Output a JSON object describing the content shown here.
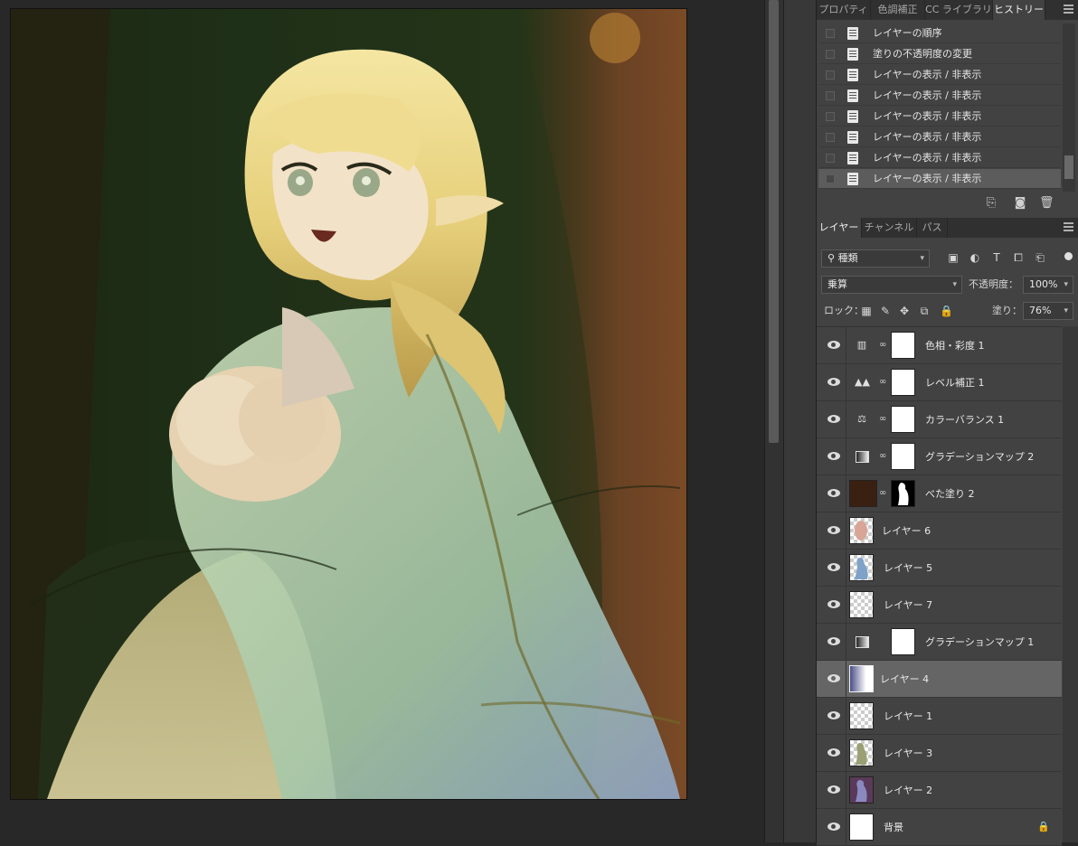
{
  "panels": {
    "top_tabs": [
      {
        "label": "プロパティ"
      },
      {
        "label": "色調補正"
      },
      {
        "label": "CC ライブラリ"
      },
      {
        "label": "ヒストリー"
      }
    ],
    "history": {
      "items": [
        {
          "label": "レイヤーの順序"
        },
        {
          "label": "塗りの不透明度の変更"
        },
        {
          "label": "レイヤーの表示 / 非表示"
        },
        {
          "label": "レイヤーの表示 / 非表示"
        },
        {
          "label": "レイヤーの表示 / 非表示"
        },
        {
          "label": "レイヤーの表示 / 非表示"
        },
        {
          "label": "レイヤーの表示 / 非表示"
        },
        {
          "label": "レイヤーの表示 / 非表示"
        }
      ]
    },
    "layers_tabs": [
      {
        "label": "レイヤー"
      },
      {
        "label": "チャンネル"
      },
      {
        "label": "パス"
      }
    ],
    "layers": {
      "filter_kind": "種類",
      "blend_mode": "乗算",
      "opacity_label": "不透明度：",
      "opacity_value": "100%",
      "lock_label": "ロック：",
      "fill_label": "塗り：",
      "fill_value": "76%",
      "items": [
        {
          "name": "色相・彩度 1",
          "icon": "hue-saturation-icon"
        },
        {
          "name": "レベル補正 1",
          "icon": "levels-icon"
        },
        {
          "name": "カラーバランス 1",
          "icon": "color-balance-icon"
        },
        {
          "name": "グラデーションマップ 2",
          "icon": "gradient-map-icon"
        },
        {
          "name": "べた塗り 2",
          "icon": "solid-fill-icon"
        },
        {
          "name": "レイヤー 6",
          "icon": "layer-thumbnail"
        },
        {
          "name": "レイヤー 5",
          "icon": "layer-thumbnail"
        },
        {
          "name": "レイヤー 7",
          "icon": "layer-thumbnail"
        },
        {
          "name": "グラデーションマップ 1",
          "icon": "gradient-map-icon"
        },
        {
          "name": "レイヤー 4",
          "icon": "layer-thumbnail"
        },
        {
          "name": "レイヤー 1",
          "icon": "layer-thumbnail"
        },
        {
          "name": "レイヤー 3",
          "icon": "layer-thumbnail"
        },
        {
          "name": "レイヤー 2",
          "icon": "layer-thumbnail"
        },
        {
          "name": "背景",
          "icon": "layer-thumbnail"
        }
      ]
    }
  },
  "colors": {
    "panel_bg": "#424242",
    "selected_row": "#656565",
    "canvas_bg": "#282828"
  }
}
